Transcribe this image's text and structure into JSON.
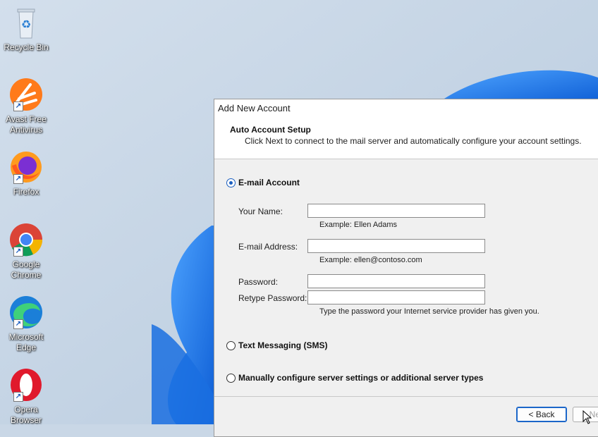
{
  "desktop": {
    "icons": [
      {
        "label": "Recycle Bin",
        "icon": "recycle-bin-icon"
      },
      {
        "label": "Avast Free Antivirus",
        "icon": "avast-icon"
      },
      {
        "label": "Firefox",
        "icon": "firefox-icon"
      },
      {
        "label": "Google Chrome",
        "icon": "chrome-icon"
      },
      {
        "label": "Microsoft Edge",
        "icon": "edge-icon"
      },
      {
        "label": "Opera Browser",
        "icon": "opera-icon"
      }
    ]
  },
  "dialog": {
    "title": "Add New Account",
    "heading": "Auto Account Setup",
    "subheading": "Click Next to connect to the mail server and automatically configure your account settings.",
    "email_option": {
      "label": "E-mail Account",
      "selected": true
    },
    "fields": {
      "name": {
        "label": "Your Name:",
        "value": "",
        "hint": "Example: Ellen Adams"
      },
      "email": {
        "label": "E-mail Address:",
        "value": "",
        "hint": "Example: ellen@contoso.com"
      },
      "password": {
        "label": "Password:",
        "value": ""
      },
      "retype_password": {
        "label": "Retype Password:",
        "value": "",
        "hint": "Type the password your Internet service provider has given you."
      }
    },
    "sms_option": {
      "label": "Text Messaging (SMS)",
      "selected": false
    },
    "manual_option": {
      "label": "Manually configure server settings or additional server types",
      "selected": false
    },
    "buttons": {
      "back": "< Back",
      "next": "Next"
    }
  },
  "colors": {
    "accent": "#1b5fbf",
    "wallpaper_bloom": "#1e78e6"
  }
}
